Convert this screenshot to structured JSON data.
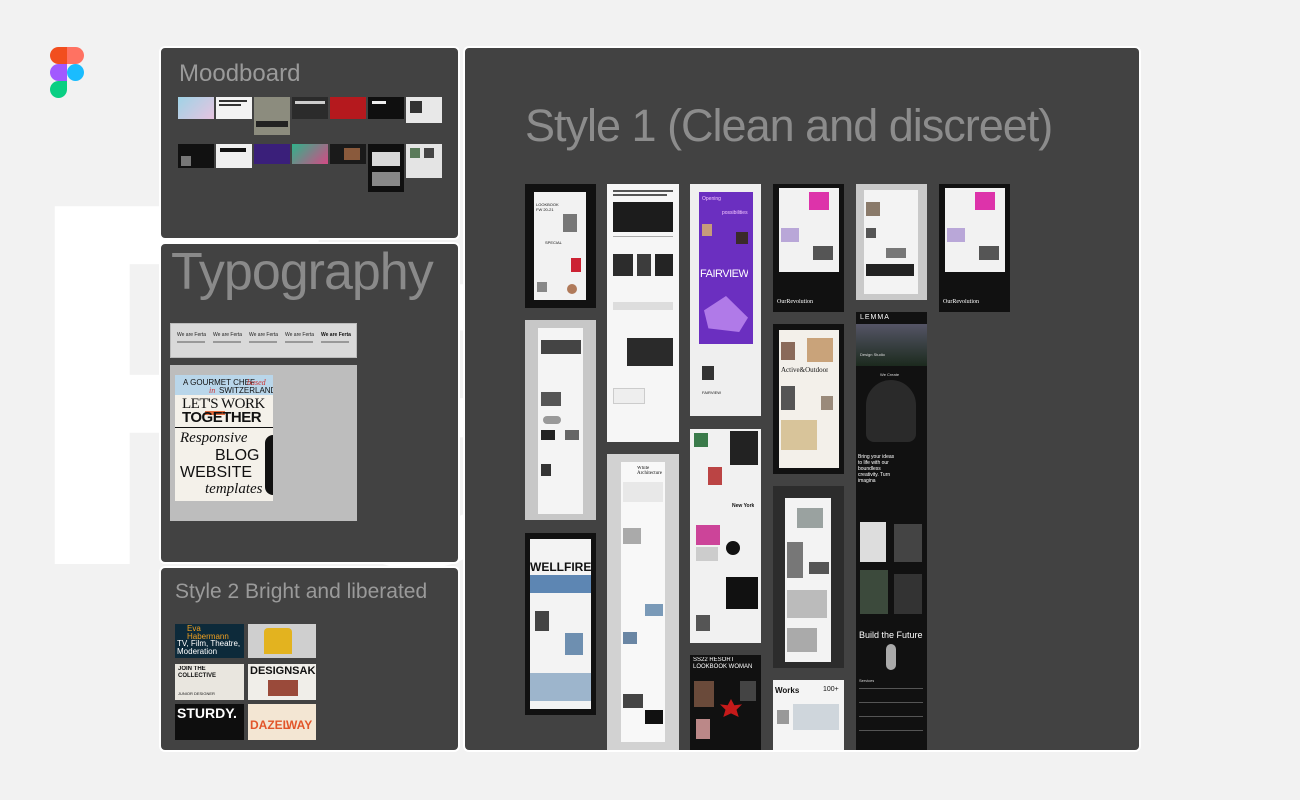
{
  "app": {
    "logo_icon": "figma-logo-icon"
  },
  "background": {
    "word": "Fa"
  },
  "moodboard": {
    "title": "Moodboard"
  },
  "typography": {
    "title": "Typography",
    "sample_items": [
      "We are Ferta",
      "We are Ferta",
      "We are Ferta",
      "We are Ferta",
      "We are Ferta"
    ],
    "poster": {
      "line1a": "A GOURMET CHEF",
      "line1b": "based",
      "line2a": "in",
      "line2b": "SWITZERLAND",
      "line3": "LET'S WORK",
      "line4": "TOGETHER",
      "line5": "Responsive",
      "line6": "BLOG",
      "line7": "WEBSITE",
      "line8": "templates"
    }
  },
  "style2": {
    "title": "Style 2  Bright and liberated",
    "cards": {
      "eva_name": "Eva Habermann",
      "eva_sub": "TV, Film, Theatre, Moderation",
      "join_title": "JOIN THE COLLECTIVE",
      "junior": "JUNIOR DESIGNER",
      "designsake": "DESIGNSAKE",
      "sturdy": "STURDY.",
      "dazel": "DAZEL",
      "way": "WAY"
    }
  },
  "style1": {
    "title": "Style 1  (Clean and discreet)",
    "cards": {
      "lookbook": "LOOKBOOK FW 20-21",
      "special": "SPECIAL",
      "opening": "Opening",
      "possibilities": "possibilities",
      "fairview": "FAIRVIEW",
      "our_revolution": "OurRevolution",
      "active_outdoor": "Active&Outdoor",
      "lemma": "LEMMA",
      "design_studio": "Design Studio",
      "we_create": "We Create",
      "bring_ideas": "Bring your ideas to life with our boundless creativity. Turn imagina",
      "build_future": "Build the Future",
      "services": "Services",
      "white_arch": "White Architecture",
      "new_york": "New York",
      "wellfire": "WELLFIRE",
      "resort": "SS22 RESORT LOOKBOOK WOMAN",
      "works": "Works",
      "count": "100+"
    }
  },
  "colors": {
    "panel": "#424242",
    "canvas": "#f2f2f2",
    "title_text": "#9a9a9a",
    "accent_purple": "#7a3cc7"
  }
}
